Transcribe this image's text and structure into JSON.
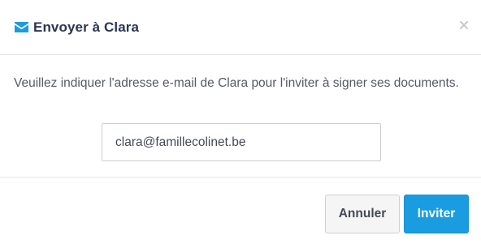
{
  "dialog": {
    "title": "Envoyer à Clara",
    "message": "Veuillez indiquer l'adresse e-mail de Clara pour l'inviter à signer ses documents.",
    "email_value": "clara@famillecolinet.be",
    "cancel_label": "Annuler",
    "invite_label": "Inviter"
  },
  "icons": {
    "title": "envelope-icon",
    "close": "close-icon"
  },
  "colors": {
    "accent": "#1a9ce0",
    "title_text": "#2c3552",
    "cancel_bg": "#f5f5f5"
  }
}
